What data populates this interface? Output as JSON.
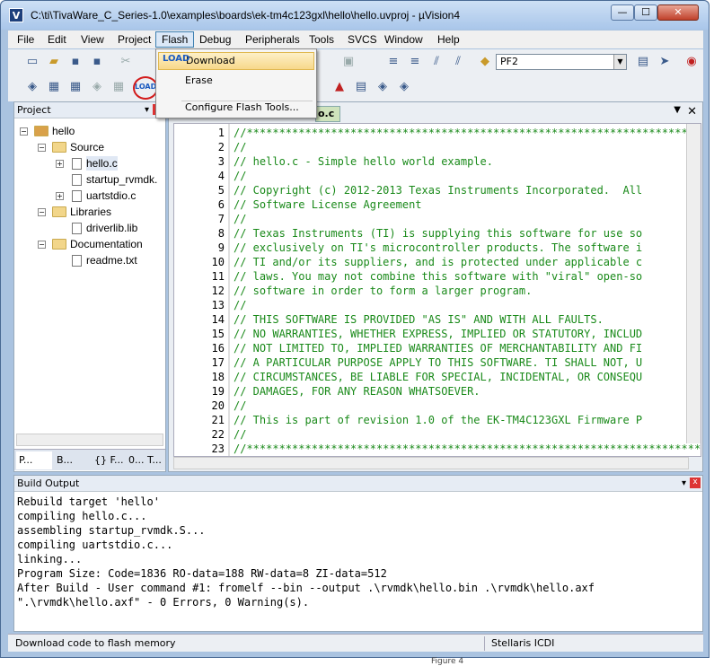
{
  "window": {
    "title": "C:\\ti\\TivaWare_C_Series-1.0\\examples\\boards\\ek-tm4c123gxl\\hello\\hello.uvproj - µVision4",
    "app_icon_letter": "V",
    "min_glyph": "—",
    "max_glyph": "☐",
    "close_glyph": "✕"
  },
  "menubar": [
    "File",
    "Edit",
    "View",
    "Project",
    "Flash",
    "Debug",
    "Peripherals",
    "Tools",
    "SVCS",
    "Window",
    "Help"
  ],
  "flash_menu": {
    "items": [
      "Download",
      "Erase",
      "Configure Flash Tools..."
    ],
    "icon_label": "LOAD"
  },
  "toolbar": {
    "target_name": "PF2",
    "load_label": "LOAD"
  },
  "project_panel": {
    "title": "Project",
    "tree": {
      "root": "hello",
      "groups": [
        {
          "name": "Source",
          "files": [
            "hello.c",
            "startup_rvmdk.",
            "uartstdio.c"
          ]
        },
        {
          "name": "Libraries",
          "files": [
            "driverlib.lib"
          ]
        },
        {
          "name": "Documentation",
          "files": [
            "readme.txt"
          ]
        }
      ]
    },
    "tabs": [
      "P...",
      "B...",
      "{} F...",
      "0... T..."
    ]
  },
  "editor": {
    "tab_label": "o.c",
    "lines": [
      {
        "n": "1",
        "t": "//*****************************************************************************"
      },
      {
        "n": "2",
        "t": "//"
      },
      {
        "n": "3",
        "t": "// hello.c - Simple hello world example."
      },
      {
        "n": "4",
        "t": "//"
      },
      {
        "n": "5",
        "t": "// Copyright (c) 2012-2013 Texas Instruments Incorporated.  All"
      },
      {
        "n": "6",
        "t": "// Software License Agreement"
      },
      {
        "n": "7",
        "t": "//"
      },
      {
        "n": "8",
        "t": "// Texas Instruments (TI) is supplying this software for use so"
      },
      {
        "n": "9",
        "t": "// exclusively on TI's microcontroller products. The software i"
      },
      {
        "n": "10",
        "t": "// TI and/or its suppliers, and is protected under applicable c"
      },
      {
        "n": "11",
        "t": "// laws. You may not combine this software with \"viral\" open-so"
      },
      {
        "n": "12",
        "t": "// software in order to form a larger program."
      },
      {
        "n": "13",
        "t": "//"
      },
      {
        "n": "14",
        "t": "// THIS SOFTWARE IS PROVIDED \"AS IS\" AND WITH ALL FAULTS."
      },
      {
        "n": "15",
        "t": "// NO WARRANTIES, WHETHER EXPRESS, IMPLIED OR STATUTORY, INCLUD"
      },
      {
        "n": "16",
        "t": "// NOT LIMITED TO, IMPLIED WARRANTIES OF MERCHANTABILITY AND FI"
      },
      {
        "n": "17",
        "t": "// A PARTICULAR PURPOSE APPLY TO THIS SOFTWARE. TI SHALL NOT, U"
      },
      {
        "n": "18",
        "t": "// CIRCUMSTANCES, BE LIABLE FOR SPECIAL, INCIDENTAL, OR CONSEQU"
      },
      {
        "n": "19",
        "t": "// DAMAGES, FOR ANY REASON WHATSOEVER."
      },
      {
        "n": "20",
        "t": "//"
      },
      {
        "n": "21",
        "t": "// This is part of revision 1.0 of the EK-TM4C123GXL Firmware P"
      },
      {
        "n": "22",
        "t": "//"
      },
      {
        "n": "23",
        "t": "//*****************************************************************************"
      }
    ]
  },
  "build_output": {
    "title": "Build Output",
    "lines": [
      "Rebuild target 'hello'",
      "compiling hello.c...",
      "assembling startup_rvmdk.S...",
      "compiling uartstdio.c...",
      "linking...",
      "Program Size: Code=1836 RO-data=188 RW-data=8 ZI-data=512",
      "After Build - User command #1: fromelf --bin --output .\\rvmdk\\hello.bin .\\rvmdk\\hello.axf",
      "\".\\rvmdk\\hello.axf\" - 0 Errors, 0 Warning(s)."
    ]
  },
  "statusbar": {
    "left": "Download code to flash memory",
    "right": "Stellaris ICDI"
  },
  "caption": "Figure 4",
  "colors": {
    "comment": "#1a8a1a",
    "highlight": "#f7d88a",
    "circle": "#d21a1a"
  }
}
